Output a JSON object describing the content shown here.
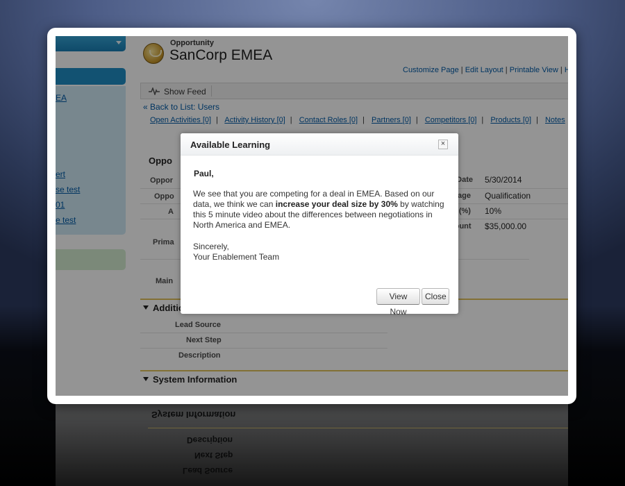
{
  "sidebar": {
    "links": [
      "EA",
      "ert",
      "se test",
      "01",
      "e test"
    ]
  },
  "record": {
    "object_type": "Opportunity",
    "name": "SanCorp EMEA"
  },
  "page_links": {
    "customize": "Customize Page",
    "edit_layout": "Edit Layout",
    "printable": "Printable View",
    "help": "He"
  },
  "feed": {
    "show_feed": "Show Feed"
  },
  "back_link": "« Back to List: Users",
  "related_lists": [
    {
      "label": "Open Activities",
      "count": "[0]"
    },
    {
      "label": "Activity History",
      "count": "[0]"
    },
    {
      "label": "Contact Roles",
      "count": "[0]"
    },
    {
      "label": "Partners",
      "count": "[0]"
    },
    {
      "label": "Competitors",
      "count": "[0]"
    },
    {
      "label": "Products",
      "count": "[0]"
    },
    {
      "label": "Notes",
      "count": ""
    }
  ],
  "detail": {
    "section_title": "Oppo",
    "left_labels": [
      "Oppor",
      "Oppo",
      "A",
      "Prima",
      "Main"
    ],
    "right_fields": [
      {
        "label": "e Date",
        "value": "5/30/2014"
      },
      {
        "label": "Stage",
        "value": "Qualification"
      },
      {
        "label": "ty (%)",
        "value": "10%"
      },
      {
        "label": "nount",
        "value": "$35,000.00"
      }
    ]
  },
  "additional_info": {
    "title": "Additional Information",
    "fields": [
      "Lead Source",
      "Next Step",
      "Description"
    ]
  },
  "system_info": {
    "title": "System Information"
  },
  "modal": {
    "title": "Available Learning",
    "close_glyph": "×",
    "greeting": "Paul,",
    "message_part1": "We see that you are competing for a deal in EMEA. Based on our data, we think we can ",
    "message_bold": "increase your deal size by 30%",
    "message_part2": " by watching this 5 minute video about the differences between negotiations in North America and EMEA.",
    "signoff_line1": "Sincerely,",
    "signoff_line2": "Your Enablement Team",
    "view_now_label": "View Now",
    "close_label": "Close"
  },
  "colors": {
    "link": "#015ba7",
    "accent_blue": "#1f8dc4",
    "section_rule": "#e1c25a"
  }
}
